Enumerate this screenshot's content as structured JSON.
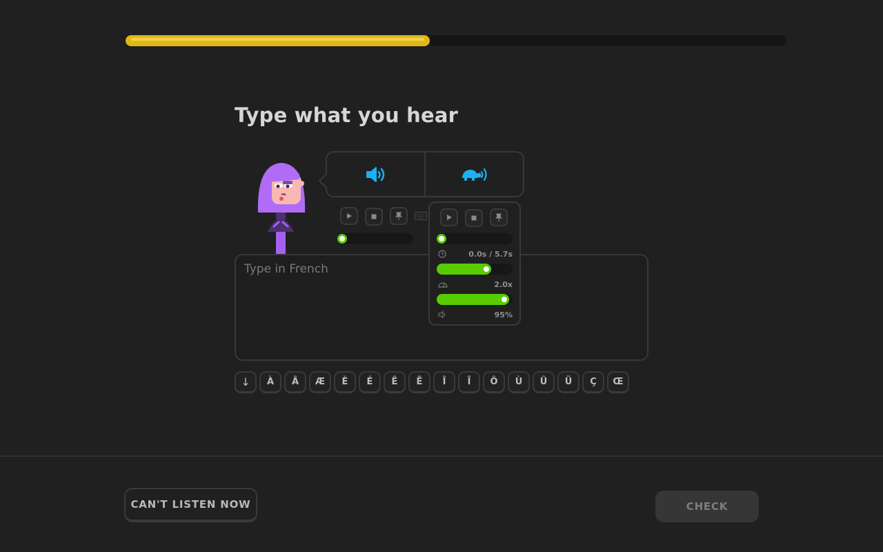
{
  "progress": {
    "value": 0.46
  },
  "prompt": {
    "title": "Type what you hear"
  },
  "audio": {
    "play_icon": "speaker-icon",
    "slow_icon": "turtle-speaker-icon"
  },
  "mini_player": {
    "position": 0.0
  },
  "popup": {
    "time_label": "0.0s / 5.7s",
    "speed_label": "2.0x",
    "volume_label": "95%",
    "position": 0.0,
    "speed": 0.68,
    "volume": 0.95
  },
  "answer": {
    "placeholder": "Type in French",
    "value": ""
  },
  "special_chars": [
    "↓",
    "À",
    "Â",
    "Æ",
    "È",
    "É",
    "Ê",
    "Ë",
    "Î",
    "Ï",
    "Ô",
    "Ù",
    "Û",
    "Ü",
    "Ç",
    "Œ"
  ],
  "footer": {
    "skip_label": "CAN'T LISTEN NOW",
    "check_label": "CHECK"
  },
  "colors": {
    "progress": "#e2b714",
    "accent": "#1cb0f6",
    "slider": "#58cc02"
  }
}
